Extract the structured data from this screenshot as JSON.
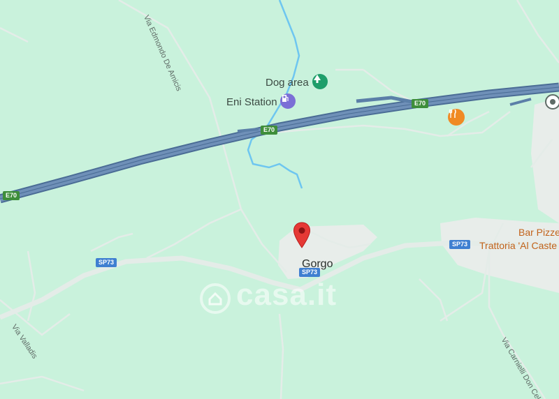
{
  "map": {
    "background_color": "#c9f2dc",
    "highway_color": "#5b7fa8",
    "minor_road_color": "#e4ece8",
    "river_color": "#6ec6f0",
    "settlement_color": "#e8edea"
  },
  "pois": {
    "dog_area": {
      "label": "Dog area",
      "icon": "tree-icon",
      "color": "#1e9e6a"
    },
    "eni_station": {
      "label": "Eni Station",
      "icon": "fuel-icon",
      "color": "#7b6fd6"
    },
    "restaurant": {
      "icon": "fork-knife-icon",
      "color": "#f08a24"
    },
    "transit": {
      "icon": "location-dot-icon",
      "color": "#5f6b66"
    }
  },
  "shields": {
    "e70_left": "E70",
    "e70_mid": "E70",
    "e70_right": "E70",
    "sp73_left": "SP73",
    "sp73_center": "SP73",
    "sp73_right": "SP73"
  },
  "road_names": {
    "via_edmondo": "Via Edmondo De Amicis",
    "via_valladis": "Via Valladis",
    "via_carnielli": "Via Carnielli Don Cel"
  },
  "places": {
    "gorgo": "Gorgo",
    "bar_pizze": "Bar Pizze",
    "trattoria": "Trattoria 'Al Caste"
  },
  "marker": {
    "icon": "map-pin-icon",
    "color": "#e53935"
  },
  "watermark": {
    "text": "casa.it",
    "icon": "house-icon"
  }
}
